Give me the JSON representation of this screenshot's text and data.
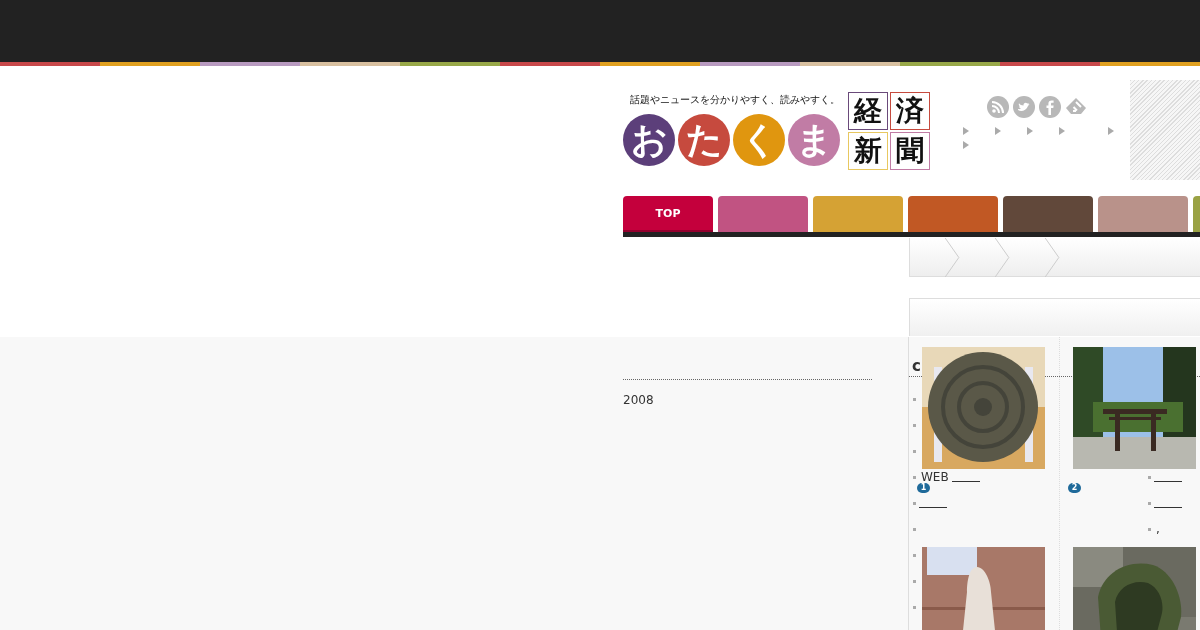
{
  "site": {
    "tagline": "話題やニュースを分かりやすく、読みやすく。",
    "logo_kana": [
      {
        "char": "お",
        "color": "#5c3f7a"
      },
      {
        "char": "た",
        "color": "#c64a3e"
      },
      {
        "char": "く",
        "color": "#e0960f"
      },
      {
        "char": "ま",
        "color": "#c17ca5"
      }
    ],
    "logo_kanji": [
      {
        "char": "経",
        "color": "#6a4a7a"
      },
      {
        "char": "済",
        "color": "#c64a3e"
      },
      {
        "char": "新",
        "color": "#e8c860"
      },
      {
        "char": "聞",
        "color": "#c17ca5"
      }
    ]
  },
  "nav": {
    "tabs": [
      {
        "label": "TOP",
        "selected": true,
        "color": "#c4003c"
      },
      {
        "selected": false,
        "color": "#c05080"
      },
      {
        "selected": false,
        "color": "#d4a030"
      },
      {
        "selected": false,
        "color": "#c05520"
      },
      {
        "selected": false,
        "color": "#5e4436"
      },
      {
        "selected": false,
        "color": "#b89088"
      },
      {
        "selected": false,
        "color": "#98a040"
      }
    ]
  },
  "archive": {
    "year": "2008"
  },
  "ranking": {
    "heading": "c",
    "list_left": [
      {
        "link": false
      },
      {
        "link": false
      },
      {
        "link": false
      },
      {
        "link": true,
        "text": "WEB"
      },
      {
        "link": true
      },
      {
        "link": false
      },
      {
        "link": false
      },
      {
        "link": false
      },
      {
        "link": false
      }
    ],
    "list_right": [
      {
        "link": true
      },
      {
        "link": true
      },
      {
        "link": false,
        "text": ","
      }
    ],
    "entries": [
      {
        "kind": "picture",
        "rank": "1"
      },
      {
        "kind": "picture",
        "rank": "2"
      },
      {
        "kind": "picture"
      },
      {
        "kind": "picture"
      }
    ]
  }
}
